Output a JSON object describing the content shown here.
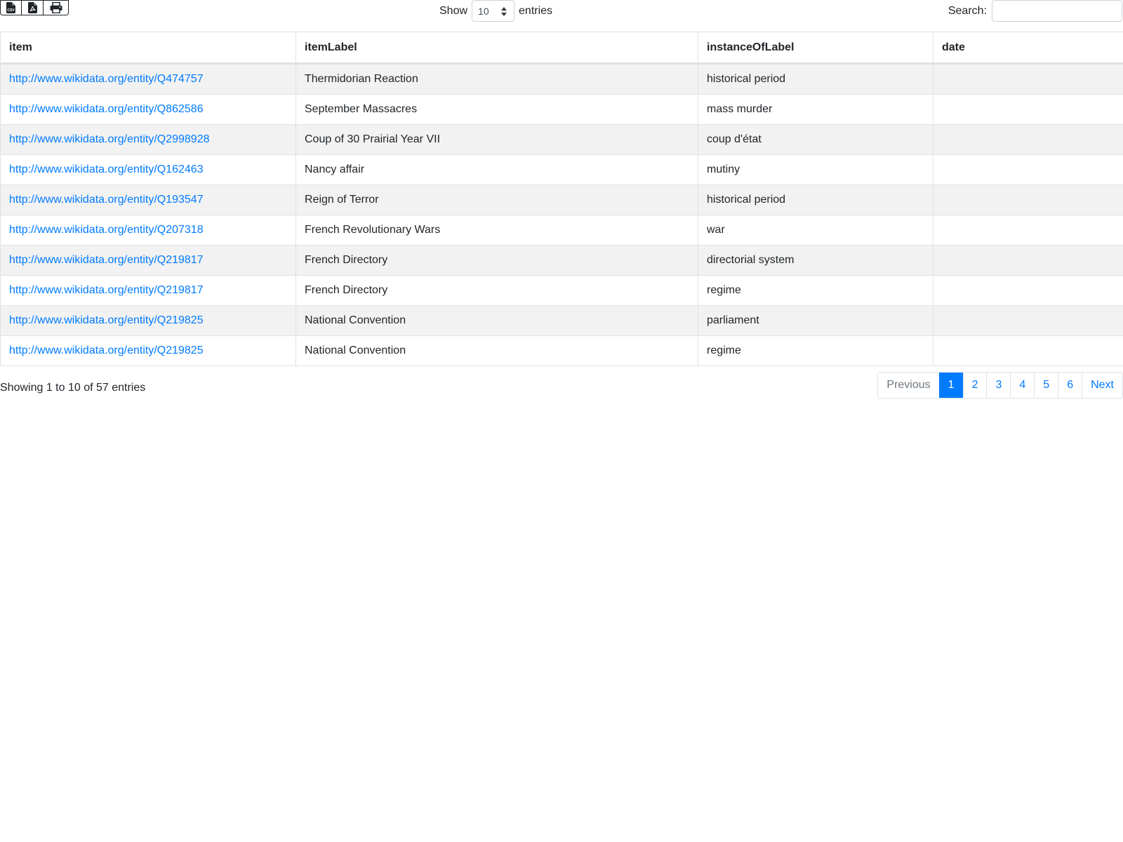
{
  "toolbar": {
    "buttons": [
      {
        "icon": "file-csv-icon",
        "label": "CSV"
      },
      {
        "icon": "file-pdf-icon",
        "label": ""
      },
      {
        "icon": "print-icon",
        "label": ""
      }
    ],
    "length": {
      "prefix": "Show",
      "selected": "10",
      "suffix": "entries"
    },
    "search": {
      "label": "Search:",
      "value": "",
      "placeholder": ""
    }
  },
  "table": {
    "columns": [
      "item",
      "itemLabel",
      "instanceOfLabel",
      "date"
    ],
    "rows": [
      [
        "http://www.wikidata.org/entity/Q474757",
        "Thermidorian Reaction",
        "historical period",
        ""
      ],
      [
        "http://www.wikidata.org/entity/Q862586",
        "September Massacres",
        "mass murder",
        ""
      ],
      [
        "http://www.wikidata.org/entity/Q2998928",
        "Coup of 30 Prairial Year VII",
        "coup d'état",
        ""
      ],
      [
        "http://www.wikidata.org/entity/Q162463",
        "Nancy affair",
        "mutiny",
        ""
      ],
      [
        "http://www.wikidata.org/entity/Q193547",
        "Reign of Terror",
        "historical period",
        ""
      ],
      [
        "http://www.wikidata.org/entity/Q207318",
        "French Revolutionary Wars",
        "war",
        ""
      ],
      [
        "http://www.wikidata.org/entity/Q219817",
        "French Directory",
        "directorial system",
        ""
      ],
      [
        "http://www.wikidata.org/entity/Q219817",
        "French Directory",
        "regime",
        ""
      ],
      [
        "http://www.wikidata.org/entity/Q219825",
        "National Convention",
        "parliament",
        ""
      ],
      [
        "http://www.wikidata.org/entity/Q219825",
        "National Convention",
        "regime",
        ""
      ]
    ]
  },
  "footer": {
    "info": "Showing 1 to 10 of 57 entries",
    "pagination": {
      "previous": "Previous",
      "pages": [
        "1",
        "2",
        "3",
        "4",
        "5",
        "6"
      ],
      "active": "1",
      "next": "Next"
    }
  },
  "colors": {
    "link": "#007bff",
    "active_page": "#007bff",
    "stripe": "#f2f2f2"
  }
}
